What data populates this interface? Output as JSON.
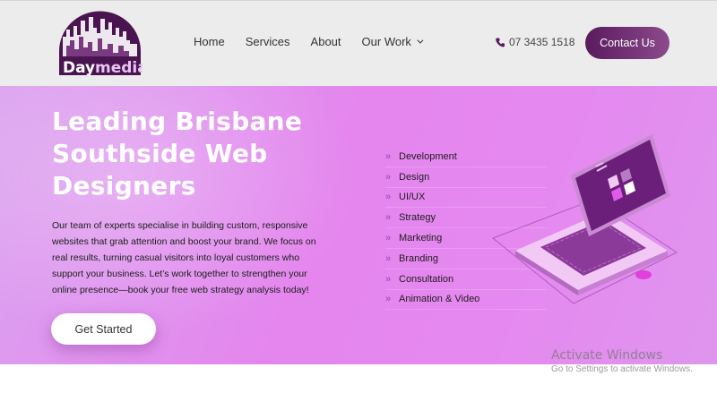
{
  "logo": {
    "text_left": "Day",
    "text_right": "media"
  },
  "nav": {
    "items": [
      {
        "label": "Home"
      },
      {
        "label": "Services"
      },
      {
        "label": "About"
      },
      {
        "label": "Our Work"
      }
    ]
  },
  "header": {
    "phone": "07 3435 1518",
    "contact_label": "Contact Us"
  },
  "hero": {
    "headline": "Leading Brisbane Southside Web Designers",
    "body": "Our team of experts specialise in building custom, responsive websites that grab attention and boost your brand. We focus on real results, turning casual visitors into loyal customers who support your business. Let’s work together to strengthen your online presence—book your free web strategy analysis today!",
    "cta_label": "Get Started"
  },
  "services": {
    "arrow": "»",
    "items": [
      "Development",
      "Design",
      "UI/UX",
      "Strategy",
      "Marketing",
      "Branding",
      "Consultation",
      "Animation & Video"
    ]
  },
  "watermark": {
    "title": "Activate Windows",
    "subtitle": "Go to Settings to activate Windows."
  },
  "colors": {
    "brand_purple": "#5a1a5e",
    "hero_pink": "#e486ee",
    "arrow_purple": "#a755c3"
  }
}
